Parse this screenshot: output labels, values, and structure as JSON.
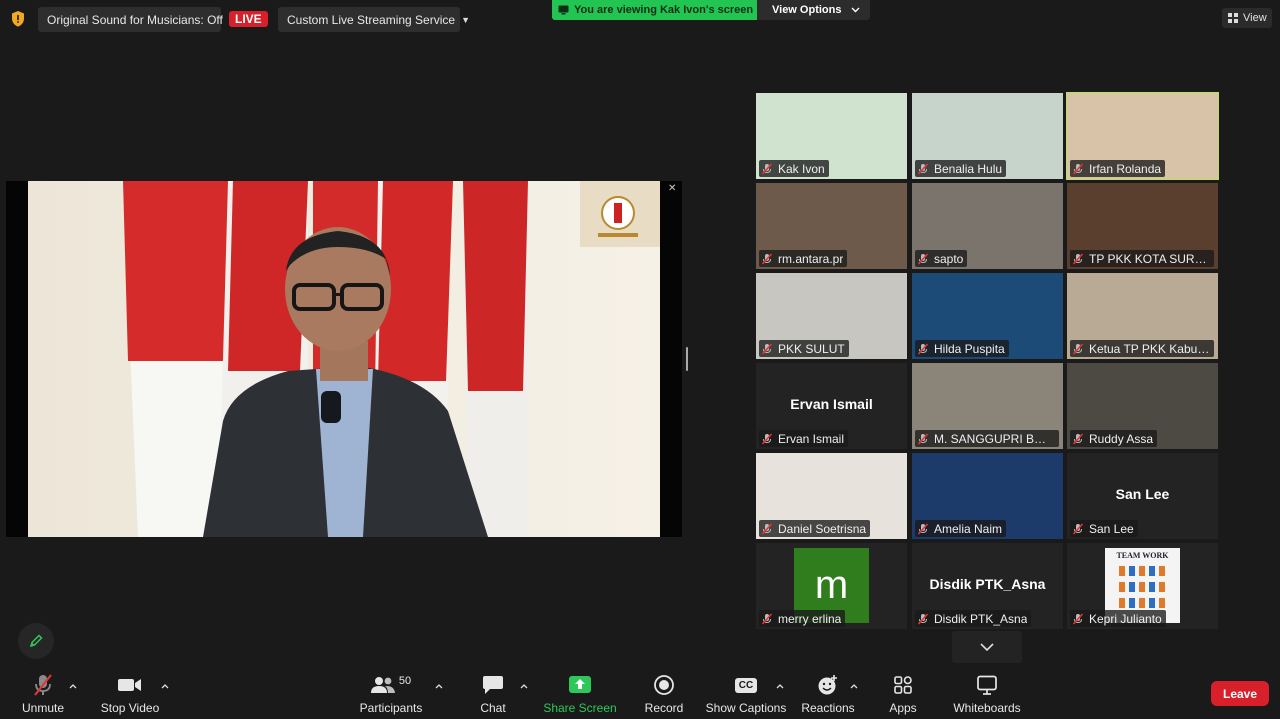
{
  "topbar": {
    "original_sound": "Original Sound for Musicians: Off",
    "live_badge": "LIVE",
    "streaming_service": "Custom Live Streaming Service",
    "viewing_banner": "You are viewing Kak Ivon's screen",
    "view_options": "View Options",
    "view": "View"
  },
  "gallery": [
    {
      "name": "Kak Ivon",
      "background": "#cfe3cf"
    },
    {
      "name": "Benalia Hulu",
      "background": "#c7d4cc"
    },
    {
      "name": "Irfan Rolanda",
      "background": "#d8c3a8",
      "active": true
    },
    {
      "name": "rm.antara.pr",
      "background": "#6d5a4a"
    },
    {
      "name": "sapto",
      "background": "#7a746c"
    },
    {
      "name": "TP PKK KOTA SURAKA...",
      "background": "#5a3e2e"
    },
    {
      "name": "PKK SULUT",
      "background": "#c8c6c0"
    },
    {
      "name": "Hilda Puspita",
      "background": "#1d4b78"
    },
    {
      "name": "Ketua TP PKK Kabup...",
      "background": "#b8aa94"
    },
    {
      "name": "Ervan Ismail",
      "display_name": "Ervan Ismail",
      "background": "#232323"
    },
    {
      "name": "M. SANGGUPRI BOC...",
      "background": "#8a8578"
    },
    {
      "name": "Ruddy Assa",
      "background": "#4d4a44"
    },
    {
      "name": "Daniel Soetrisna",
      "background": "#e7e3dc"
    },
    {
      "name": "Amelia Naim",
      "background": "#1c3a6a"
    },
    {
      "name": "San Lee",
      "display_name": "San Lee",
      "background": "#232323"
    },
    {
      "name": "merry erlina",
      "background": "#232323",
      "avatar_letter": "m",
      "avatar_color": "#2f7d1c"
    },
    {
      "name": "Disdik PTK_Asna",
      "display_name": "Disdik PTK_Asna",
      "background": "#232323"
    },
    {
      "name": "Kepri Julianto",
      "background": "#232323",
      "poster_title": "TEAM WORK"
    }
  ],
  "toolbar": {
    "unmute": "Unmute",
    "stop_video": "Stop Video",
    "participants": "Participants",
    "participant_count": "50",
    "chat": "Chat",
    "share_screen": "Share Screen",
    "record": "Record",
    "show_captions": "Show Captions",
    "reactions": "Reactions",
    "apps": "Apps",
    "whiteboards": "Whiteboards",
    "leave": "Leave",
    "captions_glyph": "CC"
  },
  "colors": {
    "live_red": "#d8202a",
    "share_green": "#23c552",
    "active_speaker": "#b9e35d",
    "leave_red": "#d8202a"
  },
  "icons": [
    "shield-icon",
    "chevron-down-icon",
    "grid-icon",
    "close-icon",
    "muted-mic-icon",
    "video-camera-icon",
    "participants-icon",
    "chat-bubble-icon",
    "share-arrow-icon",
    "record-icon",
    "captions-icon",
    "reactions-icon",
    "apps-icon",
    "whiteboard-icon",
    "pencil-icon"
  ]
}
